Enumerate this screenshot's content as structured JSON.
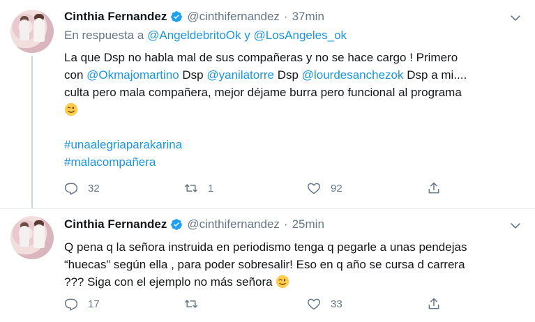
{
  "tweets": [
    {
      "author_name": "Cinthia Fernandez",
      "handle": "@cinthifernandez",
      "separator": "·",
      "time": "37min",
      "reply_prefix": "En respuesta a",
      "reply_user1": "@AngeldebritoOk",
      "reply_joiner": "y",
      "reply_user2": "@LosAngeles_ok",
      "text_line1": "La que Dsp no habla mal de sus compañeras y no se hace cargo ! Primero",
      "text_con": "con",
      "mention1": "@Okmajomartino",
      "dsp1": "Dsp",
      "mention2": "@yanilatorre",
      "dsp2": "Dsp",
      "mention3": "@lourdesanchezok",
      "text_after": "Dsp a mi....",
      "text_line3": "culta pero mala compañera, mejor déjame burra pero funcional al programa",
      "hashtag1": "#unaalegriaparakarina",
      "hashtag2": "#malacompañera",
      "replies": "32",
      "retweets": "1",
      "likes": "92"
    },
    {
      "author_name": "Cinthia Fernandez",
      "handle": "@cinthifernandez",
      "separator": "·",
      "time": "25min",
      "text_line1": "Q pena q la señora instruida en periodismo tenga q pegarle a unas pendejas",
      "text_line2": "“huecas” según ella , para poder sobresalir! Eso en q año se cursa d carrera",
      "text_line3": "??? Siga con el ejemplo no más señora",
      "replies": "17",
      "retweets": "",
      "likes": "33"
    }
  ],
  "colors": {
    "link": "#1b95e0",
    "muted": "#657786",
    "text": "#14171a",
    "verified": "#1da1f2"
  },
  "icons": [
    "verified-badge-icon",
    "chevron-down-icon",
    "reply-icon",
    "retweet-icon",
    "like-icon",
    "share-icon",
    "winking-face-icon"
  ]
}
